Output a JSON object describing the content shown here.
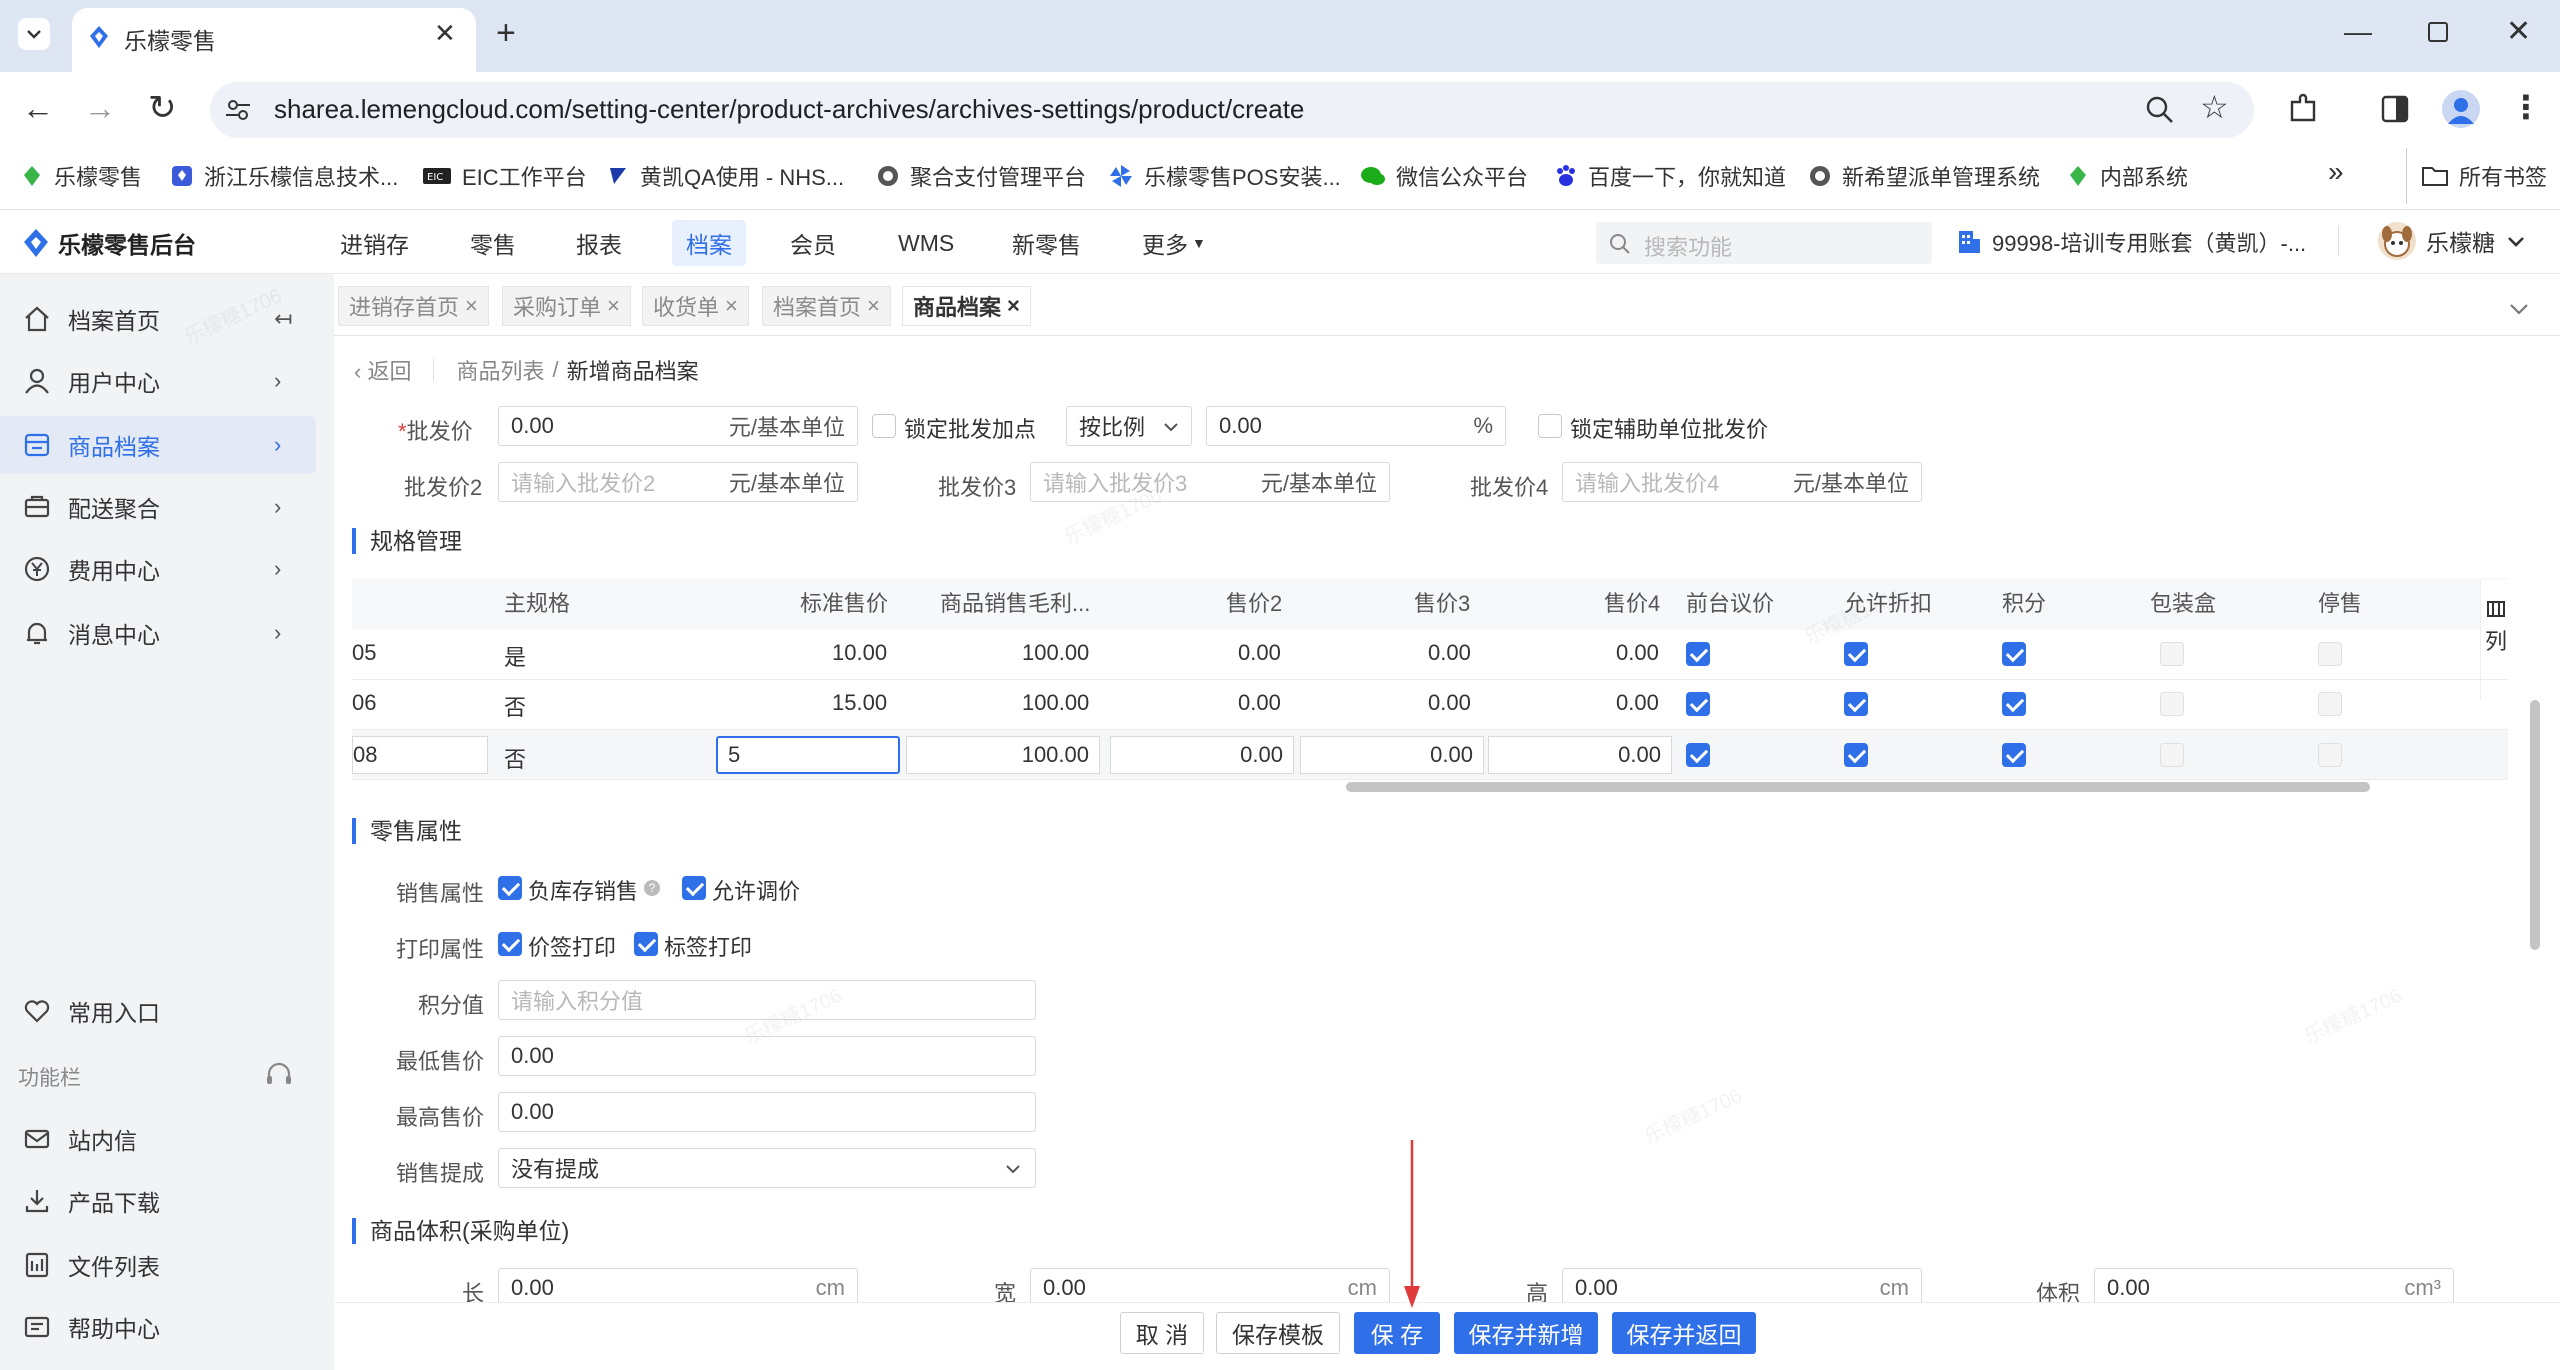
{
  "browser": {
    "tab_title": "乐檬零售",
    "url": "sharea.lemengcloud.com/setting-center/product-archives/archives-settings/product/create",
    "bookmarks": [
      {
        "label": "乐檬零售",
        "icon": "lemeng-icon"
      },
      {
        "label": "浙江乐檬信息技术...",
        "icon": "lemeng-blue-icon"
      },
      {
        "label": "EIC工作平台",
        "icon": "eic-icon"
      },
      {
        "label": "黄凯QA使用 - NHS...",
        "icon": "bolt-icon"
      },
      {
        "label": "聚合支付管理平台",
        "icon": "globe-icon"
      },
      {
        "label": "乐檬零售POS安装...",
        "icon": "windmill-icon"
      },
      {
        "label": "微信公众平台",
        "icon": "wechat-icon"
      },
      {
        "label": "百度一下，你就知道",
        "icon": "baidu-icon"
      },
      {
        "label": "新希望派单管理系统",
        "icon": "globe-icon"
      },
      {
        "label": "内部系统",
        "icon": "lemeng-icon"
      }
    ],
    "all_bookmarks": "所有书签",
    "more_bookmarks": "»"
  },
  "app": {
    "logo": "乐檬零售后台",
    "nav": [
      "进销存",
      "零售",
      "报表",
      "档案",
      "会员",
      "WMS",
      "新零售",
      "更多"
    ],
    "active_nav": "档案",
    "search_placeholder": "搜索功能",
    "account": "99998-培训专用账套（黄凯）-...",
    "user": "乐檬糖"
  },
  "sidebar": {
    "items": [
      {
        "label": "档案首页",
        "icon": "home-icon",
        "arrow": "↤"
      },
      {
        "label": "用户中心",
        "icon": "user-icon",
        "arrow": "›"
      },
      {
        "label": "商品档案",
        "icon": "product-icon",
        "arrow": "›"
      },
      {
        "label": "配送聚合",
        "icon": "delivery-icon",
        "arrow": "›"
      },
      {
        "label": "费用中心",
        "icon": "yen-icon",
        "arrow": "›"
      },
      {
        "label": "消息中心",
        "icon": "bell-icon",
        "arrow": "›"
      }
    ],
    "common_entry": "常用入口",
    "function_bar": "功能栏",
    "bottom_items": [
      {
        "label": "站内信",
        "icon": "mail-icon"
      },
      {
        "label": "产品下载",
        "icon": "download-icon"
      },
      {
        "label": "文件列表",
        "icon": "file-list-icon"
      },
      {
        "label": "帮助中心",
        "icon": "help-icon"
      }
    ]
  },
  "content_tabs": [
    "进销存首页",
    "采购订单",
    "收货单",
    "档案首页",
    "商品档案"
  ],
  "breadcrumb": {
    "back": "返回",
    "parent": "商品列表",
    "current": "新增商品档案"
  },
  "wholesale": {
    "label": "批发价",
    "value": "0.00",
    "unit": "元/基本单位",
    "lock_markup": "锁定批发加点",
    "ratio_select": "按比例",
    "percent_value": "0.00",
    "percent_unit": "%",
    "lock_aux": "锁定辅助单位批发价",
    "price2_label": "批发价2",
    "price2_placeholder": "请输入批发价2",
    "price3_label": "批发价3",
    "price3_placeholder": "请输入批发价3",
    "price4_label": "批发价4",
    "price4_placeholder": "请输入批发价4"
  },
  "spec": {
    "title": "规格管理",
    "columns": [
      "主规格",
      "标准售价",
      "商品销售毛利...",
      "售价2",
      "售价3",
      "售价4",
      "前台议价",
      "允许折扣",
      "积分",
      "包装盒",
      "停售"
    ],
    "column_setting": "列",
    "rows": [
      {
        "code": "05",
        "main": "是",
        "price": "10.00",
        "margin": "100.00",
        "p2": "0.00",
        "p3": "0.00",
        "p4": "0.00"
      },
      {
        "code": "06",
        "main": "否",
        "price": "15.00",
        "margin": "100.00",
        "p2": "0.00",
        "p3": "0.00",
        "p4": "0.00"
      },
      {
        "code": "08",
        "main": "否",
        "price": "5",
        "margin": "100.00",
        "p2": "0.00",
        "p3": "0.00",
        "p4": "0.00"
      }
    ]
  },
  "retail": {
    "title": "零售属性",
    "sales_label": "销售属性",
    "negative_stock": "负库存销售",
    "allow_price_adjust": "允许调价",
    "print_label": "打印属性",
    "price_tag_print": "价签打印",
    "label_print": "标签打印",
    "points_label": "积分值",
    "points_placeholder": "请输入积分值",
    "min_price_label": "最低售价",
    "min_price": "0.00",
    "max_price_label": "最高售价",
    "max_price": "0.00",
    "commission_label": "销售提成",
    "commission": "没有提成"
  },
  "volume": {
    "title": "商品体积(采购单位)",
    "length_label": "长",
    "length": "0.00",
    "length_unit": "cm",
    "width_label": "宽",
    "width": "0.00",
    "width_unit": "cm",
    "height_label": "高",
    "height": "0.00",
    "height_unit": "cm",
    "volume_label": "体积",
    "volume": "0.00",
    "volume_unit": "cm³"
  },
  "actions": {
    "cancel": "取 消",
    "save_template": "保存模板",
    "save": "保 存",
    "save_new": "保存并新增",
    "save_return": "保存并返回"
  },
  "watermark": "乐檬糖1706",
  "colors": {
    "primary": "#2f6fe8",
    "annotation_arrow": "#e03a3a"
  }
}
